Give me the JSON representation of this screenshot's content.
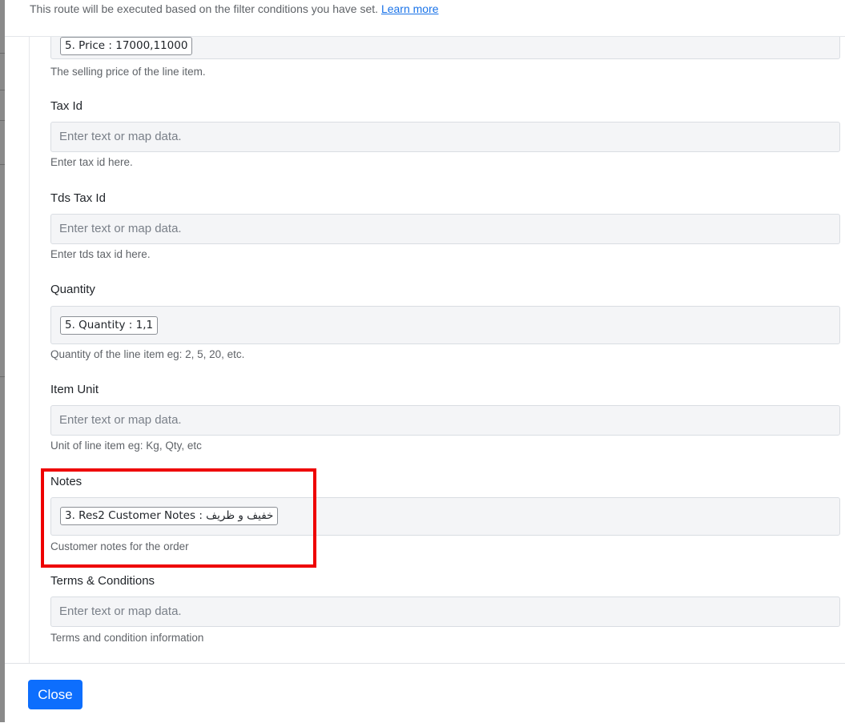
{
  "header": {
    "note": "This route will be executed based on the filter conditions you have set.",
    "learn_more": "Learn more"
  },
  "fields": {
    "price": {
      "pill": "5. Price : 17000,11000",
      "help": "The selling price of the line item."
    },
    "tax_id": {
      "label": "Tax Id",
      "placeholder": "Enter text or map data.",
      "help": "Enter tax id here."
    },
    "tds_tax_id": {
      "label": "Tds Tax Id",
      "placeholder": "Enter text or map data.",
      "help": "Enter tds tax id here."
    },
    "quantity": {
      "label": "Quantity",
      "pill": "5. Quantity : 1,1",
      "help": "Quantity of the line item eg: 2, 5, 20, etc."
    },
    "item_unit": {
      "label": "Item Unit",
      "placeholder": "Enter text or map data.",
      "help": "Unit of line item eg: Kg, Qty, etc"
    },
    "notes": {
      "label": "Notes",
      "pill": "3. Res2 Customer Notes : خفيف و ظريف",
      "help": "Customer notes for the order"
    },
    "terms": {
      "label": "Terms & Conditions",
      "placeholder": "Enter text or map data.",
      "help": "Terms and condition information"
    }
  },
  "footer": {
    "close_label": "Close"
  },
  "colors": {
    "primary": "#0d6efd",
    "highlight": "#ee0000",
    "link": "#1a73e8"
  }
}
